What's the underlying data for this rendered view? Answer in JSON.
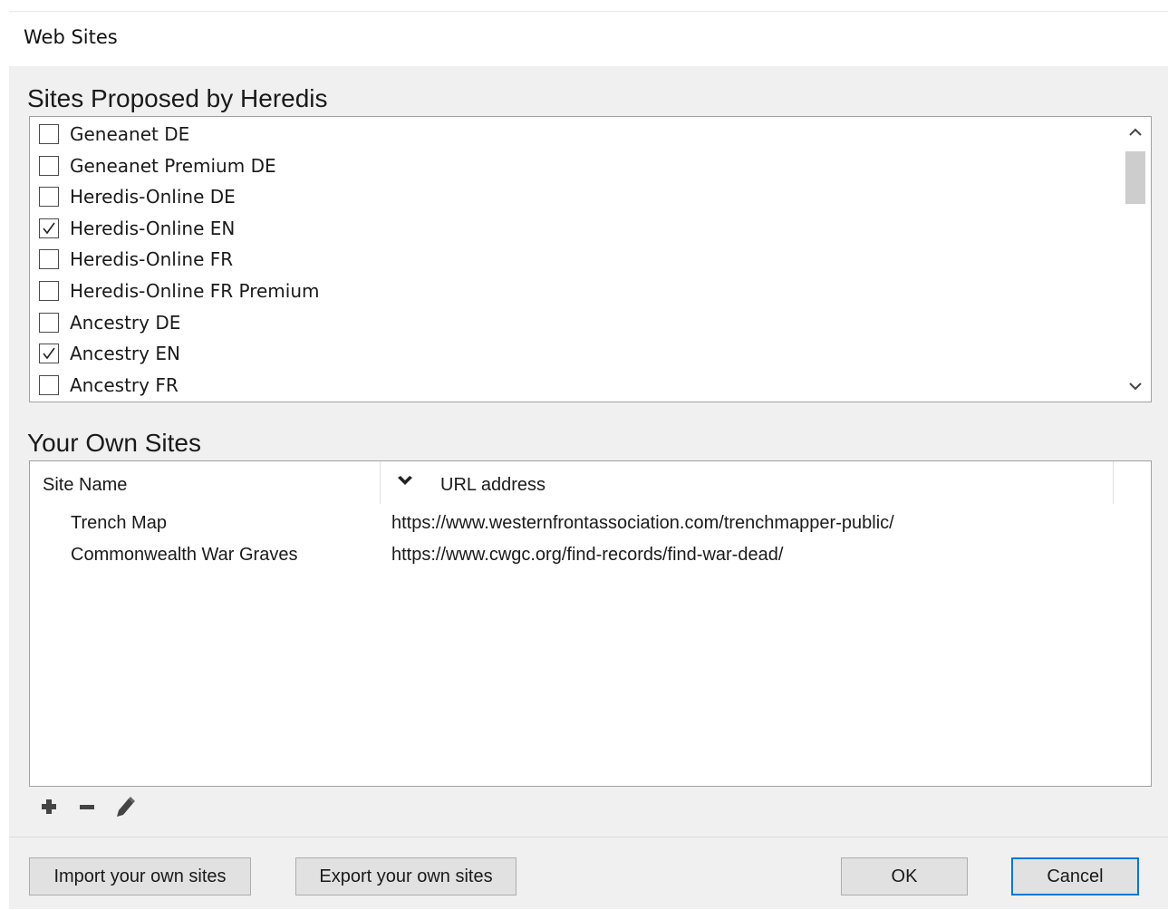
{
  "window": {
    "title": "Web Sites"
  },
  "proposed": {
    "title": "Sites Proposed by Heredis",
    "sites": [
      {
        "label": "Geneanet DE",
        "checked": false
      },
      {
        "label": "Geneanet Premium DE",
        "checked": false
      },
      {
        "label": "Heredis-Online DE",
        "checked": false
      },
      {
        "label": "Heredis-Online EN",
        "checked": true
      },
      {
        "label": "Heredis-Online FR",
        "checked": false
      },
      {
        "label": "Heredis-Online FR Premium",
        "checked": false
      },
      {
        "label": "Ancestry DE",
        "checked": false
      },
      {
        "label": "Ancestry EN",
        "checked": true
      },
      {
        "label": "Ancestry FR",
        "checked": false
      }
    ]
  },
  "own": {
    "title": "Your Own Sites",
    "columns": {
      "name": "Site Name",
      "url": "URL address"
    },
    "rows": [
      {
        "name": "Trench Map",
        "url": "https://www.westernfrontassociation.com/trenchmapper-public/"
      },
      {
        "name": "Commonwealth War Graves",
        "url": "https://www.cwgc.org/find-records/find-war-dead/"
      }
    ]
  },
  "icons": {
    "add": "plus-icon",
    "remove": "minus-icon",
    "edit": "pencil-icon",
    "sort": "chevron-down-icon",
    "scroll_up": "chevron-up-icon",
    "scroll_down": "chevron-down-icon",
    "check": "checkmark-icon"
  },
  "buttons": {
    "import": "Import your own sites",
    "export": "Export your own sites",
    "ok": "OK",
    "cancel": "Cancel"
  },
  "colors": {
    "focus_border": "#0078d7",
    "button_face": "#e1e1e1",
    "dialog_bg": "#f0f0f0"
  }
}
